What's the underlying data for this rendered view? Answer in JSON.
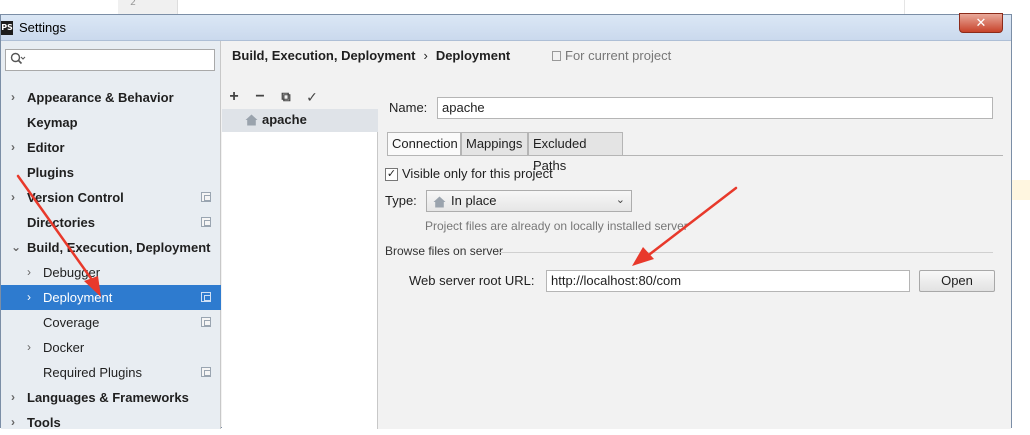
{
  "editor": {
    "line_number": "2"
  },
  "window": {
    "title": "Settings",
    "app_badge": "PS",
    "close_glyph": "✕"
  },
  "sidebar": {
    "search_placeholder": "",
    "items": [
      {
        "label": "Appearance & Behavior",
        "bold": true,
        "arrow": "›",
        "copy": false
      },
      {
        "label": "Keymap",
        "bold": true,
        "arrow": "",
        "copy": false
      },
      {
        "label": "Editor",
        "bold": true,
        "arrow": "›",
        "copy": false
      },
      {
        "label": "Plugins",
        "bold": true,
        "arrow": "",
        "copy": false
      },
      {
        "label": "Version Control",
        "bold": true,
        "arrow": "›",
        "copy": true
      },
      {
        "label": "Directories",
        "bold": true,
        "arrow": "",
        "copy": true
      },
      {
        "label": "Build, Execution, Deployment",
        "bold": true,
        "arrow": "⌄",
        "copy": false
      },
      {
        "label": "Debugger",
        "bold": false,
        "arrow": "›",
        "copy": false
      },
      {
        "label": "Deployment",
        "bold": false,
        "arrow": "›",
        "copy": true,
        "selected": true
      },
      {
        "label": "Coverage",
        "bold": false,
        "arrow": "",
        "copy": true
      },
      {
        "label": "Docker",
        "bold": false,
        "arrow": "›",
        "copy": false
      },
      {
        "label": "Required Plugins",
        "bold": false,
        "arrow": "",
        "copy": true
      },
      {
        "label": "Languages & Frameworks",
        "bold": true,
        "arrow": "›",
        "copy": false
      },
      {
        "label": "Tools",
        "bold": true,
        "arrow": "›",
        "copy": false
      }
    ]
  },
  "header": {
    "breadcrumb_parent": "Build, Execution, Deployment",
    "breadcrumb_sep": "›",
    "breadcrumb_current": "Deployment",
    "scope": "For current project"
  },
  "toolbar": {
    "add": "+",
    "remove": "−",
    "copy": "⧉",
    "apply": "✓"
  },
  "servers": [
    {
      "label": "apache"
    }
  ],
  "form": {
    "name_label": "Name:",
    "name_value": "apache",
    "tabs": [
      "Connection",
      "Mappings",
      "Excluded Paths"
    ],
    "visible_checkbox": {
      "checked": true,
      "glyph": "✓",
      "label": "Visible only for this project"
    },
    "type_label": "Type:",
    "type_value": "In place",
    "type_chevron": "⌄",
    "hint": "Project files are already on locally installed server",
    "section_title": "Browse files on server",
    "url_label": "Web server root URL:",
    "url_value": "http://localhost:80/com",
    "open_button": "Open"
  },
  "colors": {
    "selection": "#2e7bcf",
    "annotation_arrow": "#e8392b"
  }
}
